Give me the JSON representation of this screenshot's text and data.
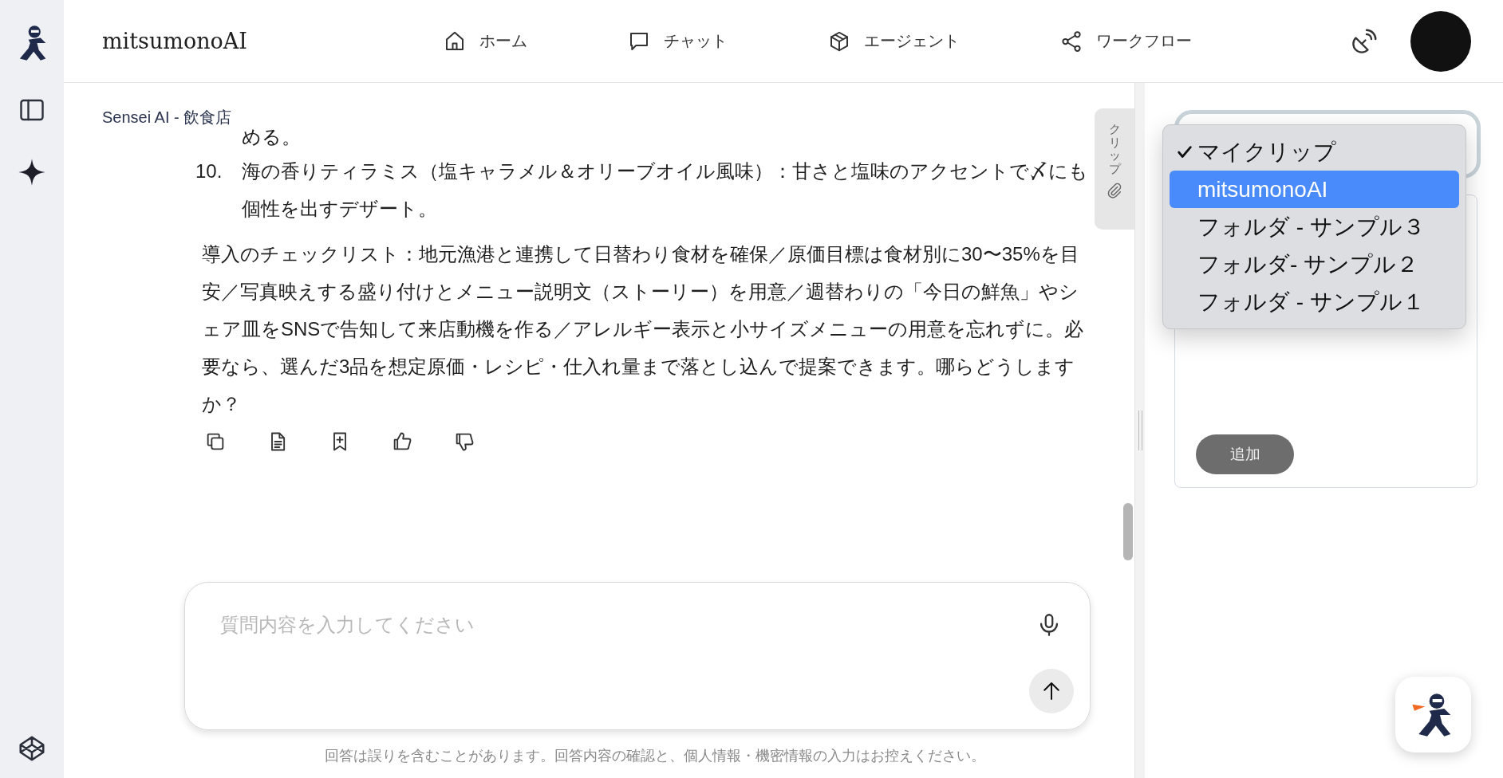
{
  "header": {
    "logo": "mitsumonoAI",
    "nav": [
      {
        "kind": "home",
        "label": "ホーム"
      },
      {
        "kind": "chat",
        "label": "チャット"
      },
      {
        "kind": "agent",
        "label": "エージェント"
      },
      {
        "kind": "workflow",
        "label": "ワークフロー"
      }
    ]
  },
  "chat": {
    "context_label": "Sensei AI - 飲食店",
    "partial_line": "める。",
    "list_items": [
      {
        "number": "10.",
        "text": "海の香りティラミス（塩キャラメル＆オリーブオイル風味）：甘さと塩味のアクセントで〆にも個性を出すデザート。"
      }
    ],
    "paragraph": "導入のチェックリスト：地元漁港と連携して日替わり食材を確保／原価目標は食材別に30〜35%を目安／写真映えする盛り付けとメニュー説明文（ストーリー）を用意／週替わりの「今日の鮮魚」やシェア皿をSNSで告知して来店動機を作る／アレルギー表示と小サイズメニューの用意を忘れずに。必要なら、選んだ3品を想定原価・レシピ・仕入れ量まで落とし込んで提案できます。哪らどうしますか？",
    "clip_tab": "クリップ",
    "input": {
      "placeholder": "質問内容を入力してください"
    },
    "disclaimer": "回答は誤りを含むことがあります。回答内容の確認と、個人情報・機密情報の入力はお控えください。"
  },
  "clip_panel": {
    "dropdown": {
      "options": [
        {
          "label": "マイクリップ",
          "selected": true,
          "highlighted": false
        },
        {
          "label": "mitsumonoAI",
          "selected": false,
          "highlighted": true
        },
        {
          "label": "フォルダ - サンプル３",
          "selected": false,
          "highlighted": false
        },
        {
          "label": "フォルダ- サンプル２",
          "selected": false,
          "highlighted": false
        },
        {
          "label": "フォルダ - サンプル１",
          "selected": false,
          "highlighted": false
        }
      ]
    },
    "add_button": "追加"
  }
}
